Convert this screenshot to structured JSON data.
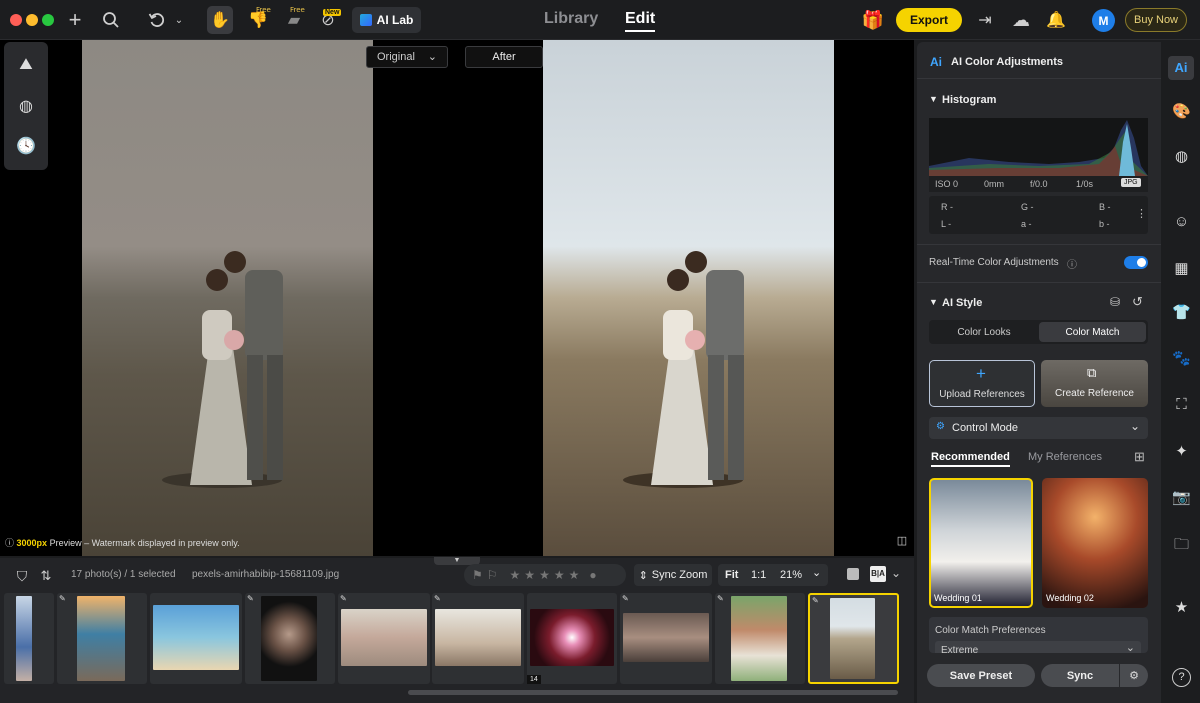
{
  "header": {
    "ai_lab_label": "AI Lab",
    "free_badge": "Free",
    "new_badge": "New",
    "tab_library": "Library",
    "tab_edit": "Edit",
    "export_label": "Export",
    "avatar_initial": "M",
    "buy_now_label": "Buy Now"
  },
  "viewer": {
    "compare_select": "Original",
    "after_label": "After",
    "notice_px": "3000px",
    "notice_text": " Preview – Watermark displayed in preview only."
  },
  "filmstrip": {
    "photo_count": "17 photo(s) / 1 selected",
    "filename": "pexels-amirhabibip-15681109.jpg",
    "sync_zoom": "Sync Zoom",
    "fit": "Fit",
    "one_to_one": "1:1",
    "zoom": "21%",
    "stack_count": "14"
  },
  "panel": {
    "title": "AI Color Adjustments",
    "histogram_title": "Histogram",
    "iso": "ISO 0",
    "focal": "0mm",
    "aperture": "f/0.0",
    "shutter": "1/0s",
    "format": "JPG",
    "r": "R -",
    "g": "G -",
    "b": "B -",
    "l": "L -",
    "a": "a -",
    "bb": "b -",
    "realtime_label": "Real-Time Color Adjustments",
    "ai_style_title": "AI Style",
    "tab_color_looks": "Color Looks",
    "tab_color_match": "Color Match",
    "upload_references": "Upload References",
    "create_reference": "Create Reference",
    "control_mode": "Control Mode",
    "tab_recommended": "Recommended",
    "tab_my_references": "My References",
    "ref1_label": "Wedding 01",
    "ref2_label": "Wedding 02",
    "preferences_label": "Color Match Preferences",
    "preferences_value": "Extreme",
    "save_preset": "Save Preset",
    "sync": "Sync"
  },
  "colors": {
    "accent_yellow": "#f5d300",
    "toggle_blue": "#1e7ee8"
  }
}
